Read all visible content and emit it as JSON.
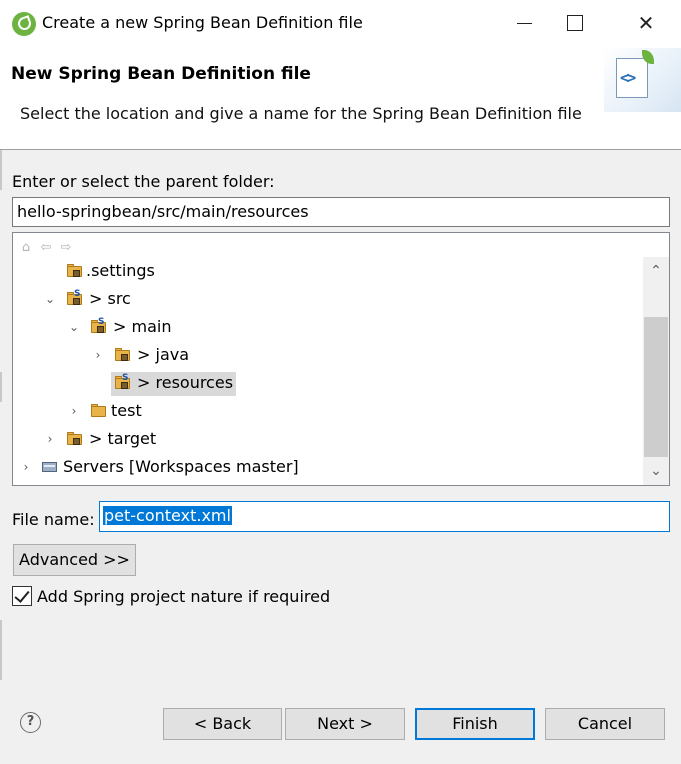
{
  "window": {
    "title": "Create a new Spring Bean Definition file",
    "minimize_glyph": "",
    "maximize_glyph": "",
    "close_glyph": "✕"
  },
  "header": {
    "title": "New Spring Bean Definition file",
    "description": "Select the location and give a name for the Spring Bean Definition file",
    "image_glyph": "<>"
  },
  "folder": {
    "label": "Enter or select the parent folder:",
    "value": "hello-springbean/src/main/resources"
  },
  "tree_toolbar": {
    "home_glyph": "⌂",
    "back_glyph": "⇦",
    "forward_glyph": "⇨"
  },
  "tree": {
    "rows": [
      {
        "label": ".settings",
        "twisty": "",
        "selected": false
      },
      {
        "label": "> src",
        "twisty": "⌄",
        "selected": false
      },
      {
        "label": "> main",
        "twisty": "⌄",
        "selected": false
      },
      {
        "label": "> java",
        "twisty": "›",
        "selected": false
      },
      {
        "label": "> resources",
        "twisty": "",
        "selected": true
      },
      {
        "label": "test",
        "twisty": "›",
        "selected": false
      },
      {
        "label": "> target",
        "twisty": "›",
        "selected": false
      },
      {
        "label": "Servers [Workspaces master]",
        "twisty": "›",
        "selected": false
      }
    ],
    "scroll_up_glyph": "⌃",
    "scroll_down_glyph": "⌄"
  },
  "filename": {
    "label": "File name:",
    "value": "pet-context.xml"
  },
  "advanced_button": "Advanced >>",
  "nature_checkbox": {
    "label": "Add Spring project nature if required",
    "checked": true
  },
  "help_glyph": "?",
  "buttons": {
    "back": "< Back",
    "next": "Next >",
    "finish": "Finish",
    "cancel": "Cancel"
  },
  "colors": {
    "accent": "#0078d7",
    "spring_green": "#6db33f",
    "selection": "#d9d9d9",
    "folder": "#e8b44a"
  }
}
